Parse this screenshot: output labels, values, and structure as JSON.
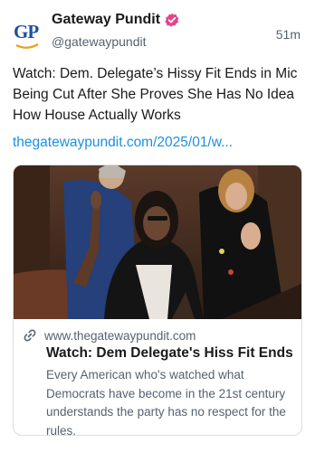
{
  "post": {
    "author_name": "Gateway Pundit",
    "author_handle": "@gatewaypundit",
    "timestamp": "51m",
    "avatar_text": "GP",
    "verified_icon": "verified-badge-icon",
    "text": "Watch: Dem. Delegate’s Hissy Fit Ends in Mic Being Cut After She Proves She Has No Idea How House Actually Works",
    "link": "thegatewaypundit.com/2025/01/w..."
  },
  "card": {
    "link_icon": "link-icon",
    "domain": "www.thegatewaypundit.com",
    "title": "Watch: Dem Delegate's Hiss Fit Ends i...",
    "description": "Every American who's watched what Democrats have become in the 21st century understands the party has no respect for the rules."
  },
  "colors": {
    "accent": "#1d8fe0",
    "brand_blue": "#1f4fa0",
    "verified": "#e0468b",
    "muted_text": "#566270"
  }
}
